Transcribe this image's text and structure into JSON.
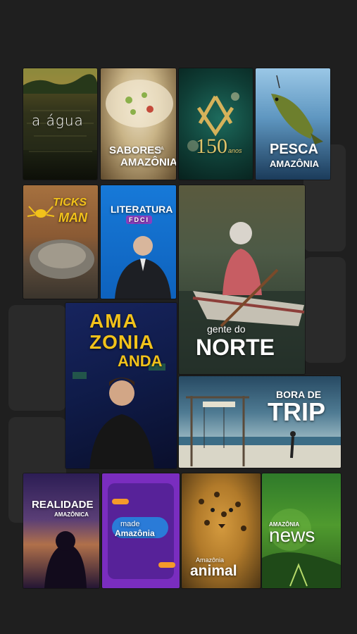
{
  "tiles": {
    "agua": {
      "title": "a água"
    },
    "sabores": {
      "line1": "SABORES",
      "small": "DA",
      "line2": "AMAZÔNIA"
    },
    "aniversario": {
      "number": "150",
      "sub": "anos"
    },
    "pesca": {
      "line1": "PESCA",
      "line2": "AMAZÔNIA"
    },
    "ticks": {
      "line1": "TICKS",
      "line2": "MAN"
    },
    "literatura": {
      "title": "LITERATURA",
      "badge": "FDCI"
    },
    "norte": {
      "line1": "gente do",
      "line2": "NORTE"
    },
    "anda": {
      "line1": "AMA",
      "line2": "ZONIA",
      "line3": "ANDA"
    },
    "trip": {
      "line1": "BORA DE",
      "line2": "TRIP"
    },
    "realidade": {
      "line1": "REALIDADE",
      "line2": "AMAZÔNICA"
    },
    "made": {
      "line1": "made",
      "line2": "Amazônia"
    },
    "animal": {
      "line1": "Amazônia",
      "line2": "animal"
    },
    "news": {
      "line1": "AMAZÔNIA",
      "line2": "news"
    }
  },
  "colors": {
    "background": "#1f1f1f",
    "ghost_card": "#2a2a2a",
    "anda_accent": "#f2c21a",
    "made_purple": "#7a2dbf",
    "literatura_blue": "#1779d8"
  }
}
